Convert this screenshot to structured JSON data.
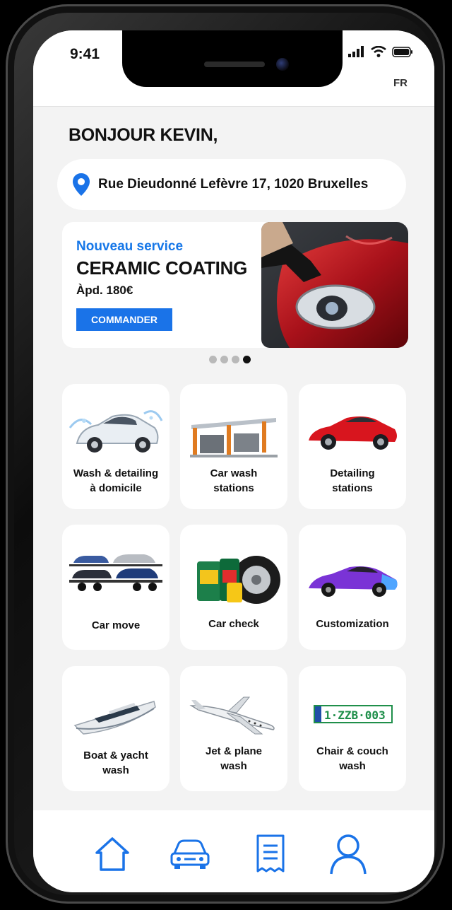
{
  "status_bar": {
    "time": "9:41"
  },
  "header": {
    "language": "FR"
  },
  "greeting": "BONJOUR KEVIN,",
  "address": {
    "icon": "location-pin-icon",
    "text": "Rue Dieudonné Lefèvre 17, 1020 Bruxelles"
  },
  "banner": {
    "kicker": "Nouveau service",
    "title": "CERAMIC COATING",
    "price": "Àpd. 180€",
    "button": "COMMANDER",
    "slides": 4,
    "active_slide": 4
  },
  "services": [
    {
      "label": "Wash & detailing\nà domicile",
      "icon": "white-car-splash"
    },
    {
      "label": "Car wash\nstations",
      "icon": "car-wash-station"
    },
    {
      "label": "Detailing\nstations",
      "icon": "red-sports-car"
    },
    {
      "label": "Car move",
      "icon": "car-transporter-truck"
    },
    {
      "label": "Car check",
      "icon": "oil-and-tire"
    },
    {
      "label": "Customization",
      "icon": "purple-supercar"
    },
    {
      "label": "Boat & yacht\nwash",
      "icon": "yacht"
    },
    {
      "label": "Jet & plane\nwash",
      "icon": "private-jet"
    },
    {
      "label": "Chair & couch\nwash",
      "icon": "license-plate",
      "plate_text": "1·ZZB·003"
    }
  ],
  "tab_bar": [
    {
      "name": "home-icon"
    },
    {
      "name": "car-icon"
    },
    {
      "name": "receipt-icon"
    },
    {
      "name": "profile-icon"
    }
  ],
  "colors": {
    "accent": "#1a73e8",
    "background": "#f3f3f3",
    "card": "#ffffff"
  }
}
